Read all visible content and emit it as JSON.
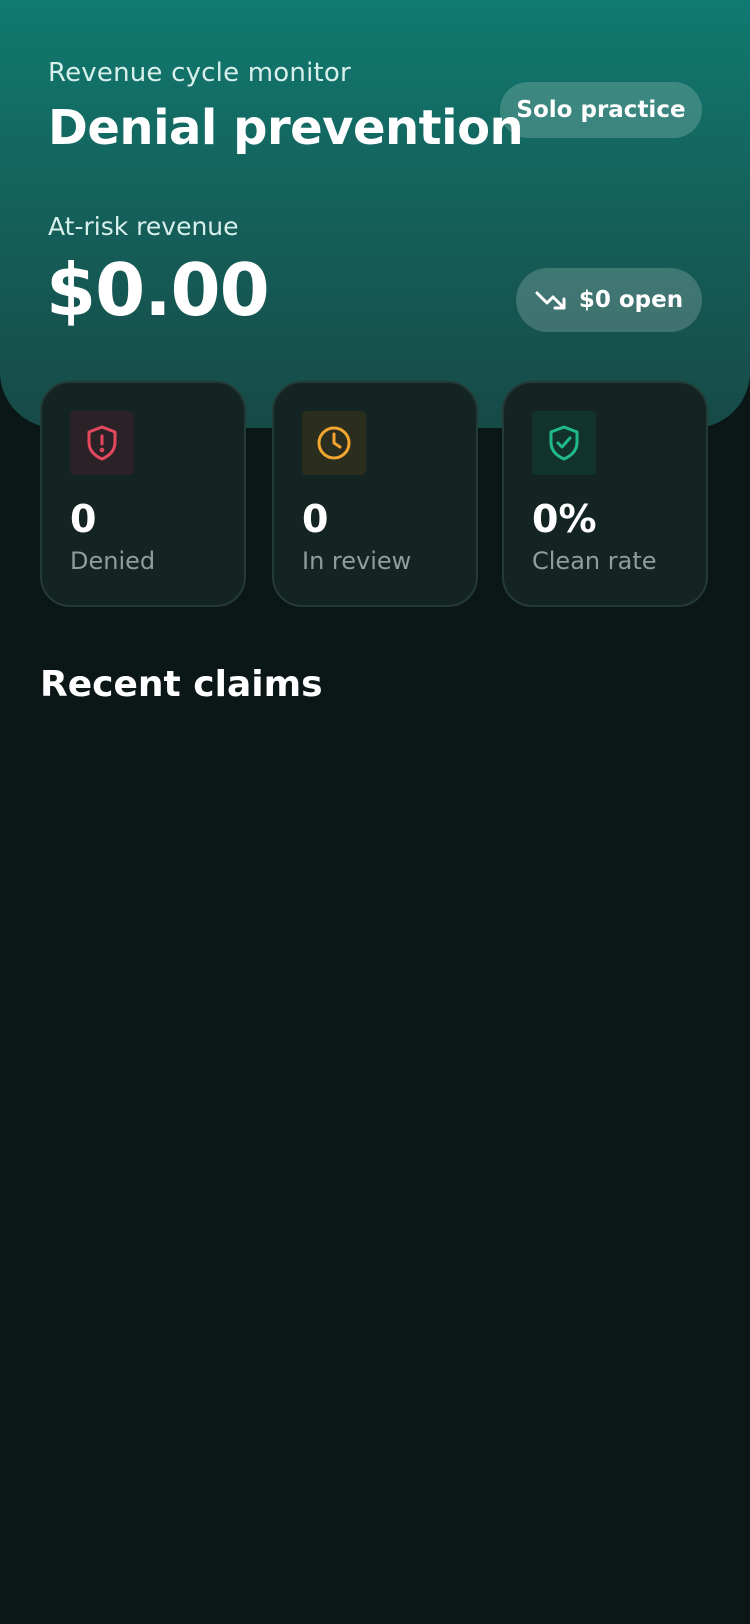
{
  "header": {
    "eyebrow": "Revenue cycle monitor",
    "title": "Denial prevention",
    "practice_badge": "Solo practice"
  },
  "revenue": {
    "label": "At-risk revenue",
    "amount": "$0.00",
    "open_badge": "$0 open",
    "open_icon": "trending-down-icon"
  },
  "stats": [
    {
      "value": "0",
      "label": "Denied",
      "icon": "shield-alert-icon",
      "color": "#e5485d",
      "bg": "#2a2226"
    },
    {
      "value": "0",
      "label": "In review",
      "icon": "clock-icon",
      "color": "#f2a531",
      "bg": "#2b2d1e"
    },
    {
      "value": "0%",
      "label": "Clean rate",
      "icon": "shield-check-icon",
      "color": "#20b98a",
      "bg": "#113329"
    }
  ],
  "recent": {
    "title": "Recent claims"
  }
}
